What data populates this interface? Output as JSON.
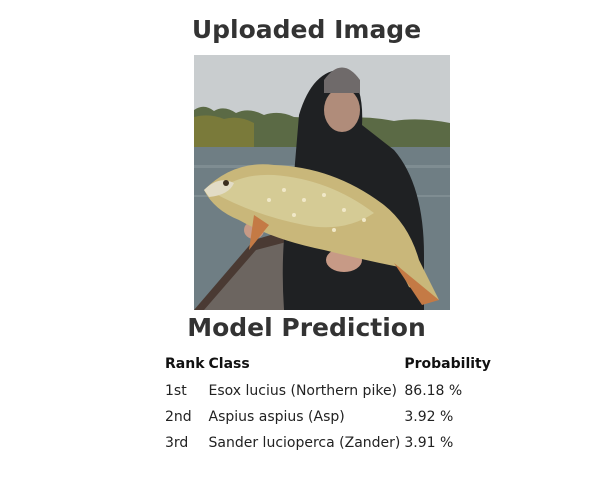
{
  "upload": {
    "heading": "Uploaded Image"
  },
  "prediction": {
    "heading": "Model Prediction",
    "columns": {
      "rank": "Rank",
      "class": "Class",
      "probability": "Probability"
    },
    "rows": [
      {
        "rank": "1st",
        "class": "Esox lucius (Northern pike)",
        "probability": "86.18 %"
      },
      {
        "rank": "2nd",
        "class": "Aspius aspius (Asp)",
        "probability": "3.92 %"
      },
      {
        "rank": "3rd",
        "class": "Sander lucioperca (Zander)",
        "probability": "3.91 %"
      }
    ]
  }
}
